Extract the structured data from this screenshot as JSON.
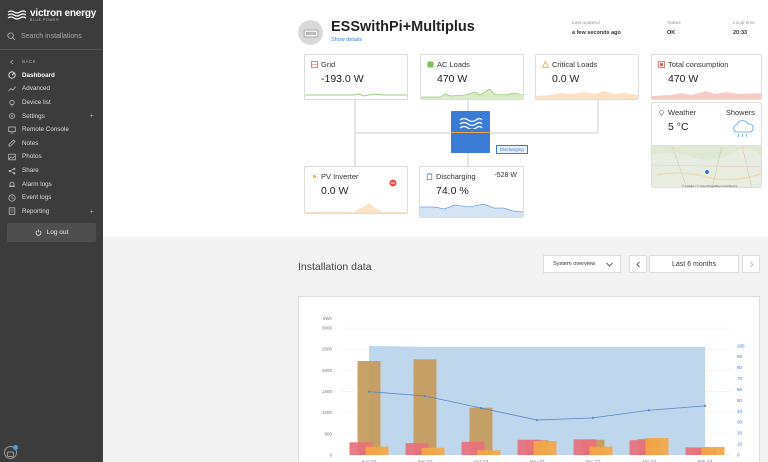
{
  "app": {
    "brand": "victron energy",
    "tagline": "BLUE POWER"
  },
  "sidebar": {
    "search_placeholder": "Search installations",
    "back_label": "BACK",
    "items": [
      {
        "label": "Dashboard",
        "icon": "dashboard-icon",
        "active": true
      },
      {
        "label": "Advanced",
        "icon": "advanced-icon"
      },
      {
        "label": "Device list",
        "icon": "device-list-icon"
      },
      {
        "label": "Settings",
        "icon": "settings-icon",
        "expandable": true
      },
      {
        "label": "Remote Console",
        "icon": "remote-console-icon"
      },
      {
        "label": "Notes",
        "icon": "notes-icon"
      },
      {
        "label": "Photos",
        "icon": "photos-icon"
      },
      {
        "label": "Share",
        "icon": "share-icon"
      },
      {
        "label": "Alarm logs",
        "icon": "alarm-logs-icon"
      },
      {
        "label": "Event logs",
        "icon": "event-logs-icon"
      },
      {
        "label": "Reporting",
        "icon": "reporting-icon",
        "expandable": true
      }
    ],
    "logout_label": "Log out"
  },
  "header": {
    "title": "ESSwithPi+Multiplus",
    "show_details": "Show details",
    "last_updated_label": "Last updated",
    "last_updated_value": "a few seconds ago",
    "status_label": "Status",
    "status_value": "OK",
    "local_time_label": "Local time",
    "local_time_value": "20:33"
  },
  "cards": {
    "grid": {
      "title": "Grid",
      "value": "-193.0 W",
      "color": "#7dbe5a"
    },
    "ac_loads": {
      "title": "AC Loads",
      "value": "470 W",
      "color": "#7dbe5a"
    },
    "critical_loads": {
      "title": "Critical Loads",
      "value": "0.0 W",
      "color": "#f4a547"
    },
    "total_consumption": {
      "title": "Total consumption",
      "value": "470 W",
      "color": "#e8604c"
    },
    "weather": {
      "title": "Weather",
      "value": "5 °C",
      "condition": "Showers"
    },
    "pv_inverter": {
      "title": "PV Inverter",
      "value": "0.0 W",
      "color": "#f4a547"
    },
    "battery": {
      "title": "Discharging",
      "value": "74.0 %",
      "power": "-528 W",
      "color": "#3a7bd5"
    }
  },
  "inverter": {
    "state_label": "Discharging"
  },
  "map": {
    "attribution": "© Leaflet | © OpenStreetMap contributors"
  },
  "installation_data": {
    "title": "Installation data",
    "view_select": "System overview",
    "period": "Last 6 months"
  },
  "colors": {
    "sidebar_bg": "#3c3c3c",
    "accent_blue": "#3a7bd5",
    "bar_brown": "#c49a5a",
    "bar_red": "#e8707c",
    "bar_orange": "#f4a547",
    "area_blue": "#a9c9e6"
  },
  "chart_data": {
    "type": "bar",
    "ylabel": "kWh",
    "ylim": [
      0,
      3000
    ],
    "y_ticks": [
      0,
      500,
      1000,
      1500,
      2000,
      2500,
      3000
    ],
    "y2_ticks": [
      0,
      10,
      20,
      30,
      40,
      50,
      60,
      70,
      80,
      90,
      100
    ],
    "categories": [
      "Aug '23",
      "Sep '23",
      "Oct '23",
      "Nov '23",
      "Dec '23",
      "Jan '24",
      "Feb '24"
    ],
    "series": [
      {
        "kind": "bar",
        "values": [
          2220,
          2260,
          1120,
          350,
          360,
          380,
          150
        ],
        "color": "#c49a5a",
        "offset": 0
      },
      {
        "kind": "bar",
        "values": [
          300,
          280,
          310,
          360,
          370,
          350,
          180
        ],
        "color": "#e8707c",
        "offset": -1
      },
      {
        "kind": "bar",
        "values": [
          200,
          170,
          110,
          330,
          200,
          400,
          190
        ],
        "color": "#f4a547",
        "offset": 1
      },
      {
        "kind": "area",
        "values": [
          100,
          99,
          99,
          99,
          99,
          99,
          99
        ],
        "color": "#a9c9e6"
      },
      {
        "kind": "line",
        "values": [
          58,
          54,
          43,
          32,
          34,
          41,
          45
        ],
        "color": "#5b86c9"
      }
    ]
  }
}
